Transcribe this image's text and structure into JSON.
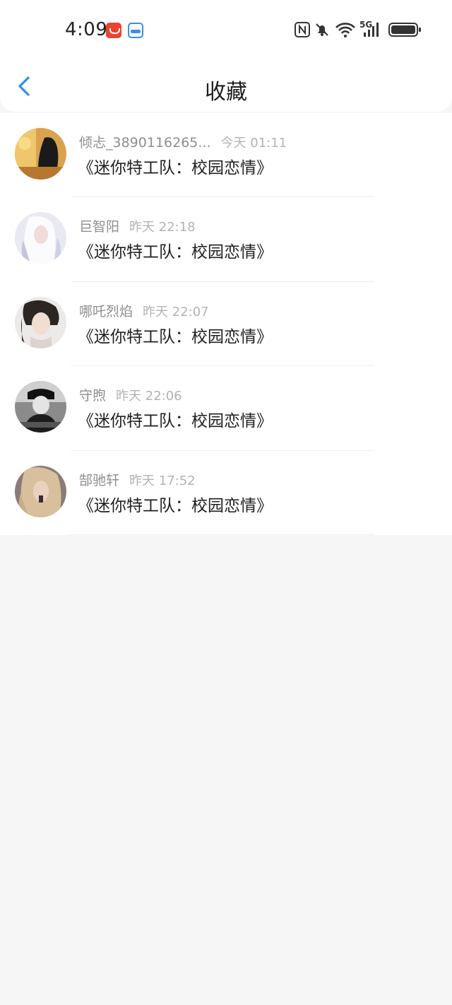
{
  "status_bar": {
    "time": "4:09",
    "network_label": "5G",
    "icons": [
      "message-app-icon",
      "calendar-100-icon",
      "nfc-icon",
      "mute-icon",
      "wifi-icon",
      "signal-icon",
      "battery-icon"
    ]
  },
  "header": {
    "title": "收藏",
    "back_icon": "chevron-left-icon",
    "accent_color": "#2f8ff0"
  },
  "favorites": [
    {
      "name": "倾忐_3890116265...",
      "time": "今天 01:11",
      "message": "《迷你特工队：校园恋情》"
    },
    {
      "name": "巨智阳",
      "time": "昨天 22:18",
      "message": "《迷你特工队：校园恋情》"
    },
    {
      "name": "哪吒烈焰",
      "time": "昨天 22:07",
      "message": "《迷你特工队：校园恋情》"
    },
    {
      "name": "守煦",
      "time": "昨天 22:06",
      "message": "《迷你特工队：校园恋情》"
    },
    {
      "name": "郜驰轩",
      "time": "昨天 17:52",
      "message": "《迷你特工队：校园恋情》"
    }
  ]
}
